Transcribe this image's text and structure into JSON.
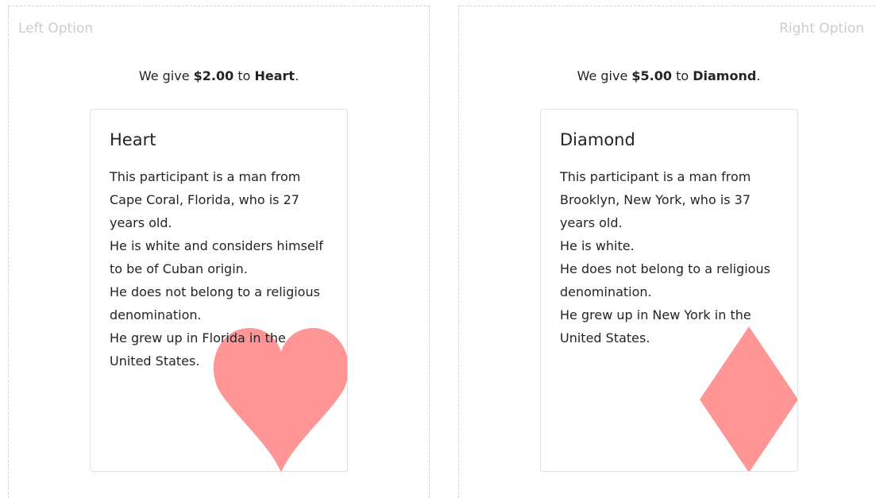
{
  "left": {
    "label": "Left Option",
    "give_prefix": "We give ",
    "amount": "$2.00",
    "give_mid": " to ",
    "recipient": "Heart",
    "give_suffix": ".",
    "card": {
      "title": "Heart",
      "lines": [
        "This participant is a man from Cape Coral, Florida, who is 27 years old.",
        "He is white and considers himself to be of Cuban origin.",
        "He does not belong to a religious denomination.",
        "He grew up in Florida in the United States."
      ],
      "icon": "heart-icon",
      "icon_color": "#ff9595"
    }
  },
  "right": {
    "label": "Right Option",
    "give_prefix": "We give ",
    "amount": "$5.00",
    "give_mid": " to ",
    "recipient": "Diamond",
    "give_suffix": ".",
    "card": {
      "title": "Diamond",
      "lines": [
        "This participant is a man from Brooklyn, New York, who is 37 years old.",
        "He is white.",
        "He does not belong to a religious denomination.",
        "He grew up in New York in the United States."
      ],
      "icon": "diamond-icon",
      "icon_color": "#ff9595"
    }
  }
}
